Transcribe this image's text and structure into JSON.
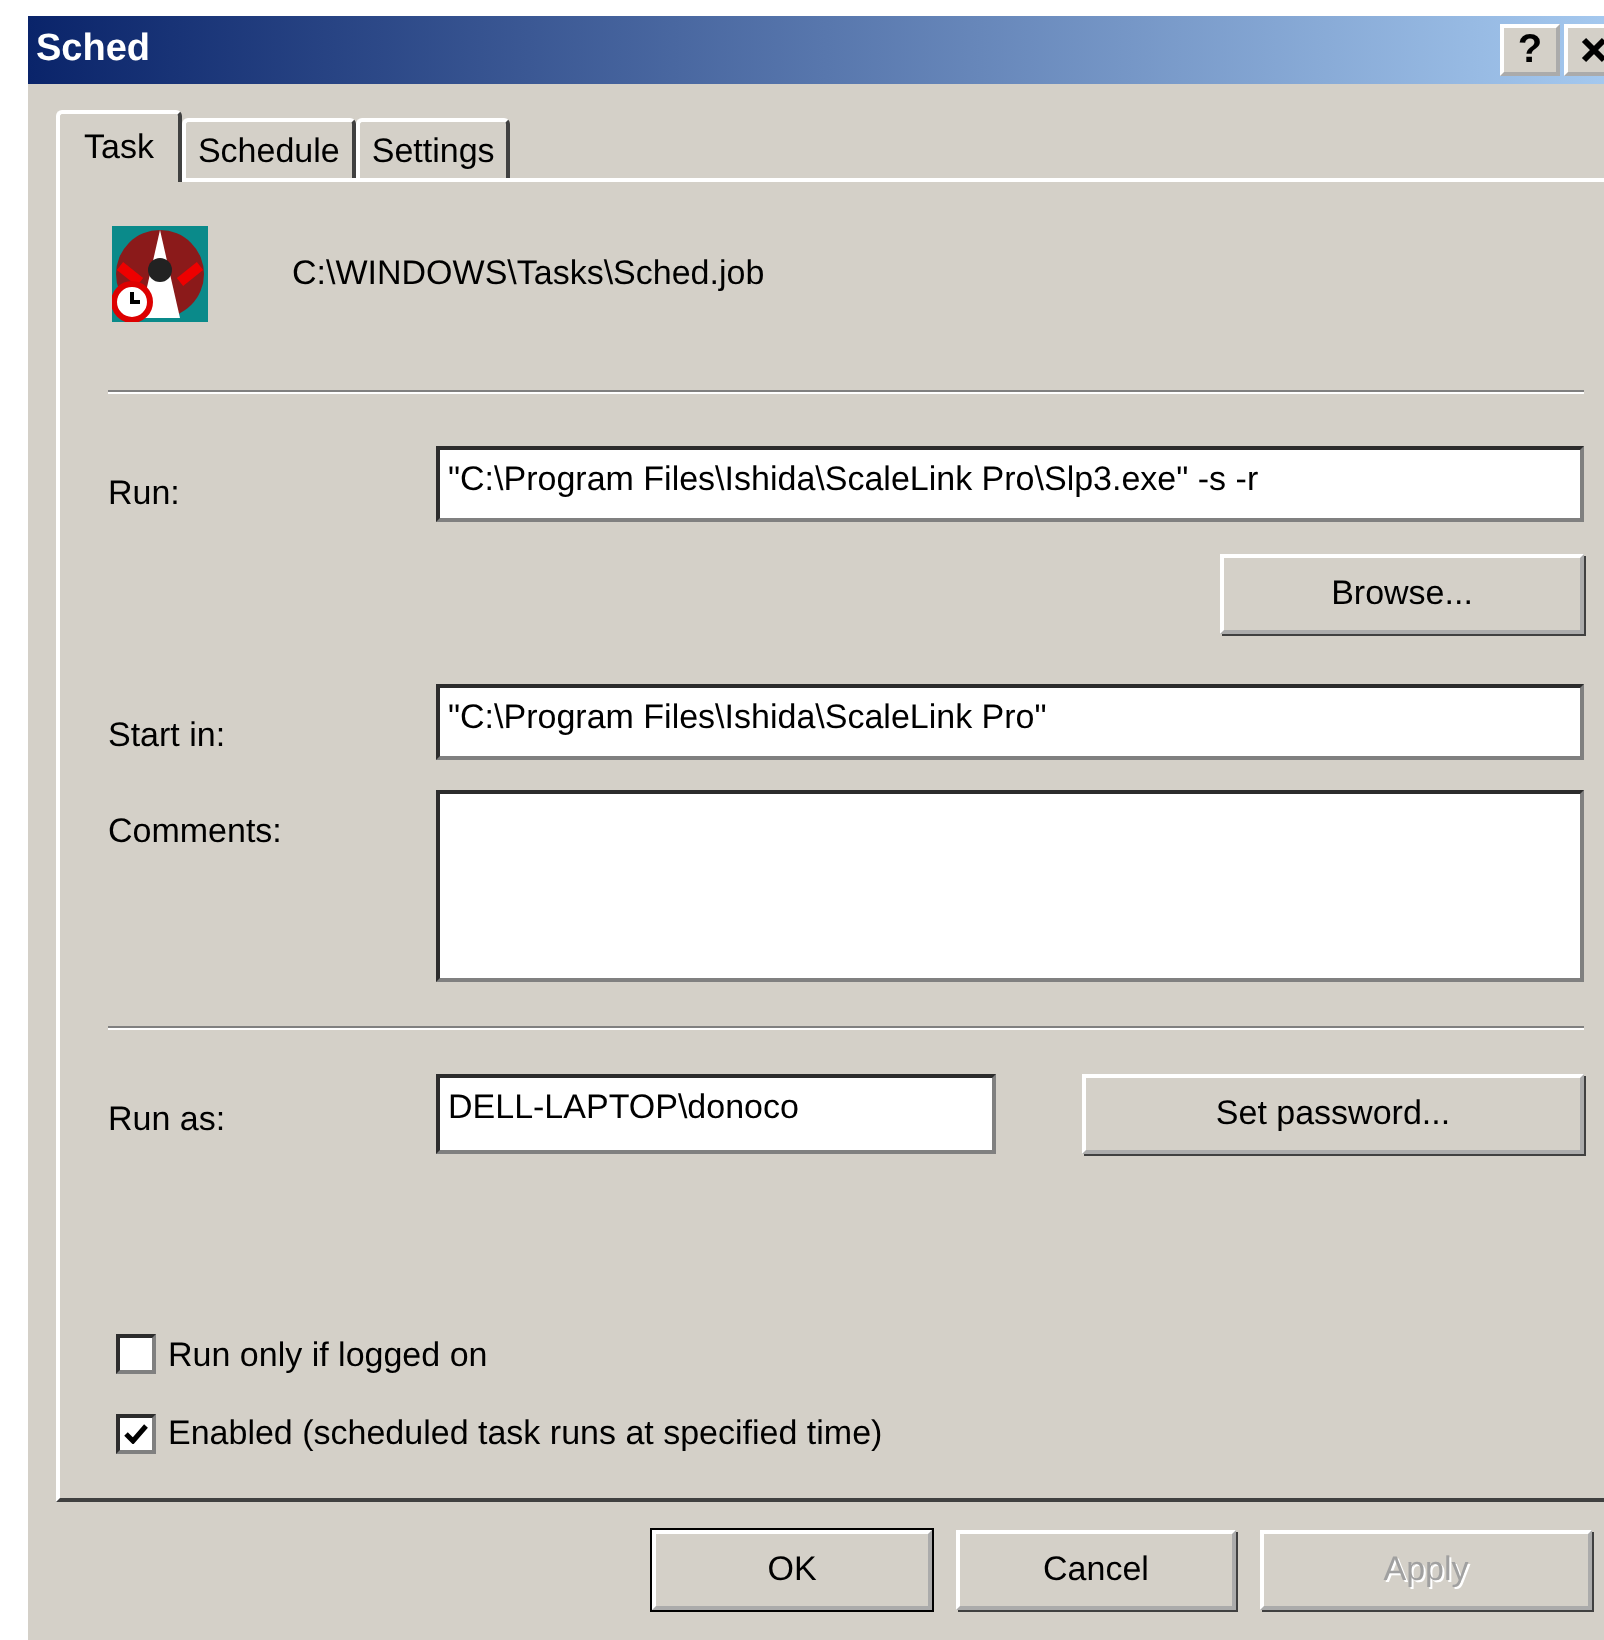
{
  "window": {
    "title": "Sched",
    "help_button": "?"
  },
  "tabs": [
    {
      "label": "Task",
      "selected": true
    },
    {
      "label": "Schedule",
      "selected": false
    },
    {
      "label": "Settings",
      "selected": false
    }
  ],
  "file_path": "C:\\WINDOWS\\Tasks\\Sched.job",
  "run": {
    "label": "Run:",
    "value": "\"C:\\Program Files\\Ishida\\ScaleLink Pro\\Slp3.exe\" -s -r",
    "button": "Browse..."
  },
  "start_in": {
    "label": "Start in:",
    "value": "\"C:\\Program Files\\Ishida\\ScaleLink Pro\""
  },
  "comments": {
    "label": "Comments:"
  },
  "run_as": {
    "label": "Run as:",
    "value": "DELL-LAPTOP\\donoco",
    "button": "Set password..."
  },
  "checkboxes": [
    {
      "label": "Run only if logged on",
      "checked": false
    },
    {
      "label": "Enabled (scheduled task runs at specified time)",
      "checked": true
    }
  ],
  "buttons": [
    {
      "label": "OK",
      "disabled": false,
      "default": true
    },
    {
      "label": "Cancel",
      "disabled": false,
      "default": false
    },
    {
      "label": "Apply",
      "disabled": true,
      "default": false
    }
  ]
}
